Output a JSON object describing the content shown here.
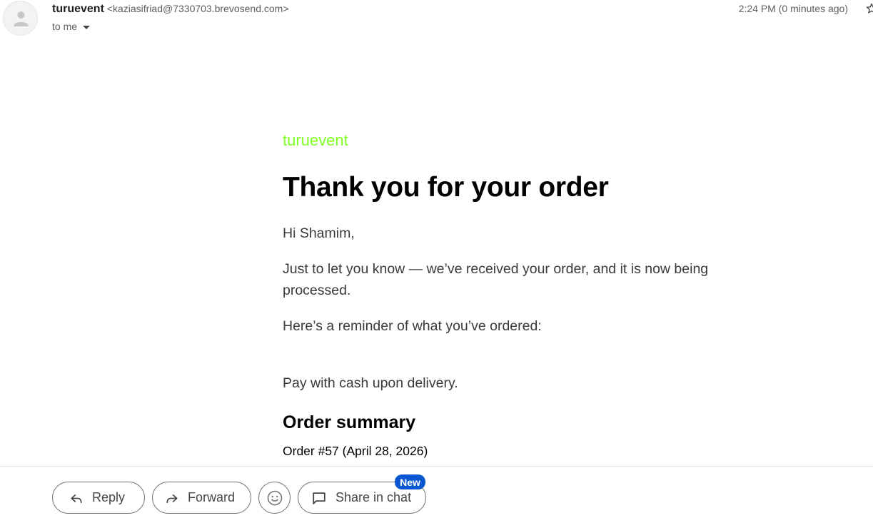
{
  "header": {
    "sender_name": "turuevent",
    "sender_email": "<kaziasifriad@7330703.brevosend.com>",
    "recipient": "to me",
    "timestamp": "2:24 PM (0 minutes ago)"
  },
  "message": {
    "brand": "turuevent",
    "heading": "Thank you for your order",
    "greeting": "Hi Shamim,",
    "received": "Just to let you know — we’ve received your order, and it is now being processed.",
    "reminder": "Here’s a reminder of what you’ve ordered:",
    "payment": "Pay with cash upon delivery.",
    "summary_title": "Order summary",
    "order_line": "Order #57 (April 28, 2026)"
  },
  "actions": {
    "reply": "Reply",
    "forward": "Forward",
    "share": "Share in chat",
    "new_badge": "New"
  },
  "colors": {
    "brand": "#7fff22",
    "badge": "#0b57d0"
  }
}
